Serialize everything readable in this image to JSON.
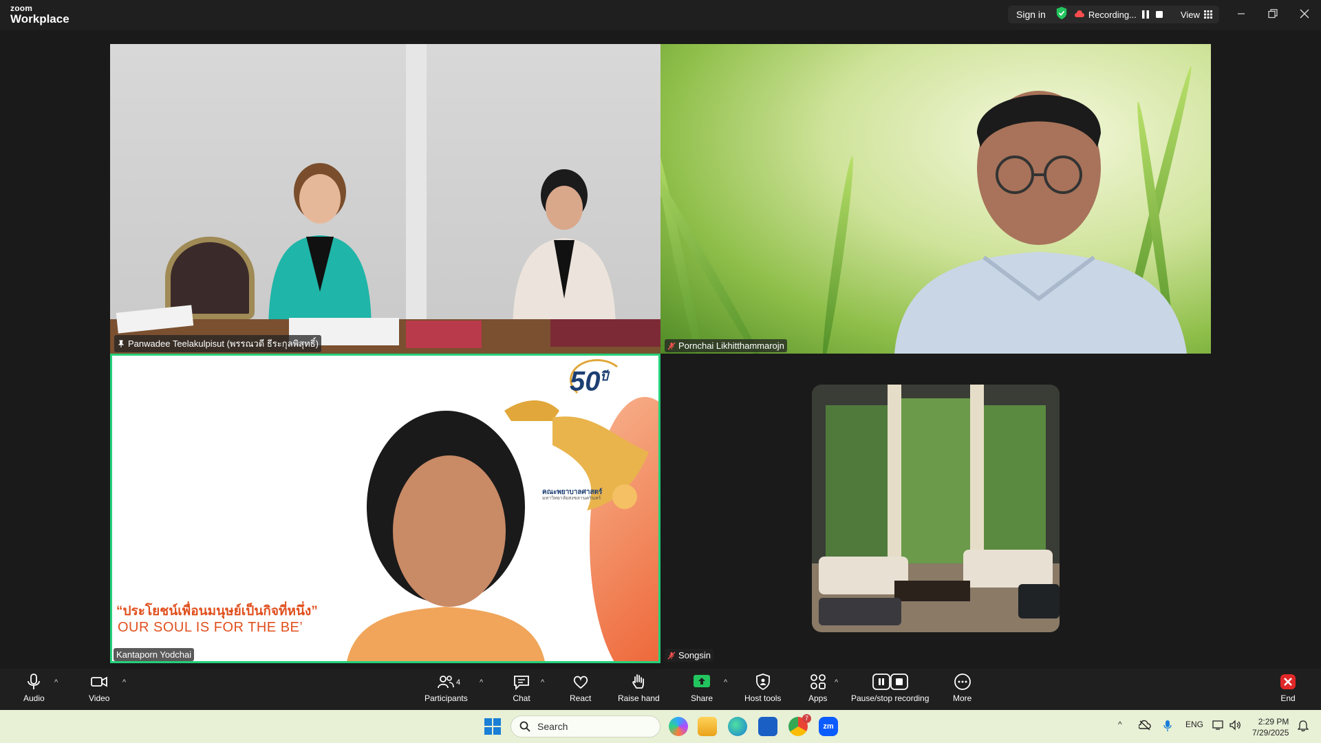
{
  "app": {
    "logo_small": "zoom",
    "logo_big": "Workplace"
  },
  "titlebar": {
    "sign_in": "Sign in",
    "recording": "Recording...",
    "view": "View",
    "security_color": "#22c55e"
  },
  "participants": [
    {
      "name": "Panwadee Teelakulpisut (พรรณวดี ธีระกุลพิสุทธิ์)",
      "pinned": true
    },
    {
      "name": "Pornchai Likhitthammarojn",
      "muted": true
    },
    {
      "name": "Kantaporn Yodchai",
      "active_speaker": true
    },
    {
      "name": "Songsin",
      "muted": true
    }
  ],
  "slide": {
    "fifty": "50",
    "fifty_suffix": "ปี",
    "faculty": "คณะพยาบาลศาสตร์",
    "faculty_sub": "มหาวิทยาลัยสงขลานครินทร์",
    "thai_quote": "“ประโยชน์เพื่อนมนุษย์เป็นกิจที่หนึ่ง”",
    "english": "OUR SOUL IS FOR THE BE’"
  },
  "toolbar": {
    "audio": "Audio",
    "video": "Video",
    "participants": "Participants",
    "participants_count": "4",
    "chat": "Chat",
    "react": "React",
    "raise_hand": "Raise hand",
    "share": "Share",
    "host_tools": "Host tools",
    "apps": "Apps",
    "pause_stop": "Pause/stop recording",
    "more": "More",
    "end": "End"
  },
  "taskbar": {
    "search_placeholder": "Search",
    "lang": "ENG",
    "time": "2:29 PM",
    "date": "7/29/2025",
    "chrome_badge": "7"
  }
}
